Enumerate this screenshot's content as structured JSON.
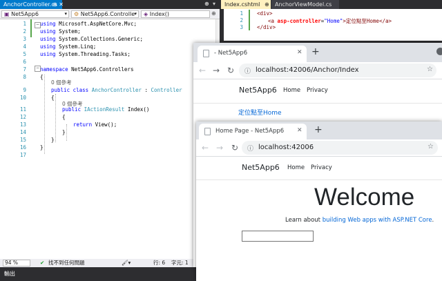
{
  "vs": {
    "tabs": [
      {
        "label": "AnchorController.cs",
        "icons": "⊕ ✕"
      },
      {
        "label": "Index.cshtml",
        "icons": "⊕"
      },
      {
        "label": "AnchorViewModel.cs",
        "icons": ""
      }
    ],
    "nav": {
      "project": "Net5App6",
      "class": "Net5App6.Controlle",
      "member": "Index()"
    },
    "code_lines": [
      {
        "n": "1",
        "t": "using Microsoft.AspNetCore.Mvc;"
      },
      {
        "n": "2",
        "t": "using System;"
      },
      {
        "n": "3",
        "t": "using System.Collections.Generic;"
      },
      {
        "n": "4",
        "t": "using System.Linq;"
      },
      {
        "n": "5",
        "t": "using System.Threading.Tasks;"
      },
      {
        "n": "6",
        "t": ""
      },
      {
        "n": "7",
        "t": "namespace Net5App6.Controllers"
      },
      {
        "n": "8",
        "t": "{"
      },
      {
        "n": "9",
        "t": "public class AnchorController : Controller"
      },
      {
        "n": "10",
        "t": "{"
      },
      {
        "n": "11",
        "t": "public IActionResult Index()"
      },
      {
        "n": "12",
        "t": "{"
      },
      {
        "n": "13",
        "t": "return View();"
      },
      {
        "n": "14",
        "t": "}"
      },
      {
        "n": "15",
        "t": "}"
      },
      {
        "n": "16",
        "t": "}"
      },
      {
        "n": "17",
        "t": ""
      }
    ],
    "refs_class": "0 個參考",
    "refs_method": "0 個參考",
    "razor_lines": [
      {
        "n": "1",
        "open": "<div>"
      },
      {
        "n": "2",
        "tag": "<a",
        "attr": "asp-controller",
        "val": "\"Home\"",
        "text": ">定位點至Home</a>"
      },
      {
        "n": "3",
        "open": "</div>"
      }
    ],
    "status": {
      "zoom": "94 %",
      "issues": "找不到任何問題",
      "line": "行: 6",
      "col": "字元: 1"
    },
    "output_label": "輸出"
  },
  "browser1": {
    "tab_title": "- Net5App6",
    "url": "localhost:42006/Anchor/Index",
    "brand": "Net5App6",
    "nav": [
      "Home",
      "Privacy"
    ],
    "anchor_text": "定位點至Home"
  },
  "browser2": {
    "tab_title": "Home Page - Net5App6",
    "url": "localhost:42006",
    "brand": "Net5App6",
    "nav": [
      "Home",
      "Privacy"
    ],
    "welcome": "Welcome",
    "learn_prefix": "Learn about ",
    "learn_link": "building Web apps with ASP.NET Core",
    "learn_suffix": "."
  }
}
